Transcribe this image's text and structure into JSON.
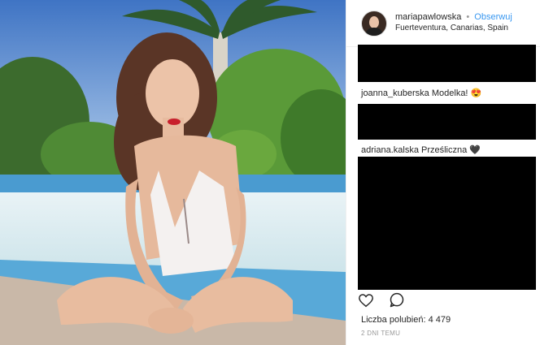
{
  "post": {
    "username": "mariapawlowska",
    "separator": "•",
    "follow_label": "Obserwuj",
    "location": "Fuerteventura, Canarias, Spain"
  },
  "comments": [
    {
      "user": "joanna_kuberska",
      "text": "Modelka! 😍"
    },
    {
      "user": "adriana.kalska",
      "text": "Prześliczna 🖤"
    }
  ],
  "likes": {
    "label": "Liczba polubień:",
    "count": "4 479"
  },
  "timestamp": "2 DNI TEMU",
  "icons": {
    "like": "heart-icon",
    "comment": "comment-bubble-icon"
  },
  "colors": {
    "follow": "#3897f0",
    "text": "#262626",
    "muted": "#999999"
  }
}
